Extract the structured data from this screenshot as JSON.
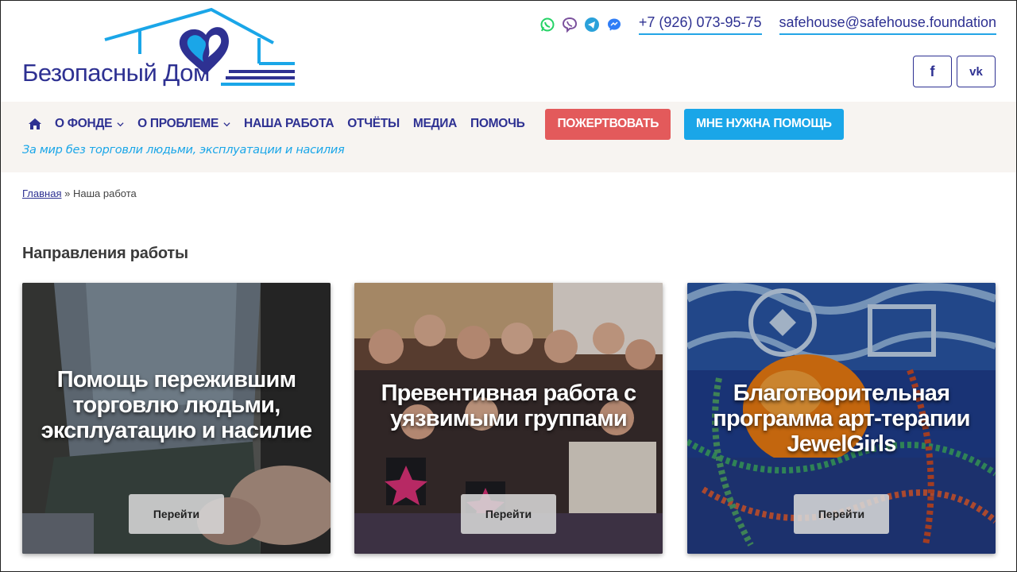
{
  "brand": {
    "logo_text": "Безопасный Дом",
    "colors": {
      "navy": "#2e3192",
      "blue": "#1aa6e8",
      "red": "#e35a5b",
      "band": "#f7f4f1"
    }
  },
  "contacts": {
    "messengers": [
      "whatsapp-icon",
      "viber-icon",
      "telegram-icon",
      "messenger-icon"
    ],
    "phone": "+7 (926) 073-95-75",
    "email": "safehouse@safehouse.foundation"
  },
  "social": {
    "facebook": "f",
    "vk": "vk"
  },
  "nav": {
    "items": [
      {
        "label": "О ФОНДЕ",
        "dropdown": true
      },
      {
        "label": "О ПРОБЛЕМЕ",
        "dropdown": true
      },
      {
        "label": "НАША РАБОТА",
        "dropdown": false
      },
      {
        "label": "ОТЧЁТЫ",
        "dropdown": false
      },
      {
        "label": "МЕДИА",
        "dropdown": false
      },
      {
        "label": "ПОМОЧЬ",
        "dropdown": false
      }
    ],
    "donate_label": "ПОЖЕРТВОВАТЬ",
    "help_label": "МНЕ НУЖНА ПОМОЩЬ",
    "tagline": "За мир без торговли людьми, эксплуатации и насилия"
  },
  "breadcrumb": {
    "home": "Главная",
    "separator": "»",
    "current": "Наша работа"
  },
  "section": {
    "title": "Направления работы"
  },
  "cards": [
    {
      "title": "Помощь пережившим торговлю людьми, эксплуатацию и насилие",
      "button": "Перейти"
    },
    {
      "title": "Превентивная работа с уязвимыми группами",
      "button": "Перейти"
    },
    {
      "title": "Благотворительная программа арт-терапии JewelGirls",
      "button": "Перейти"
    }
  ]
}
